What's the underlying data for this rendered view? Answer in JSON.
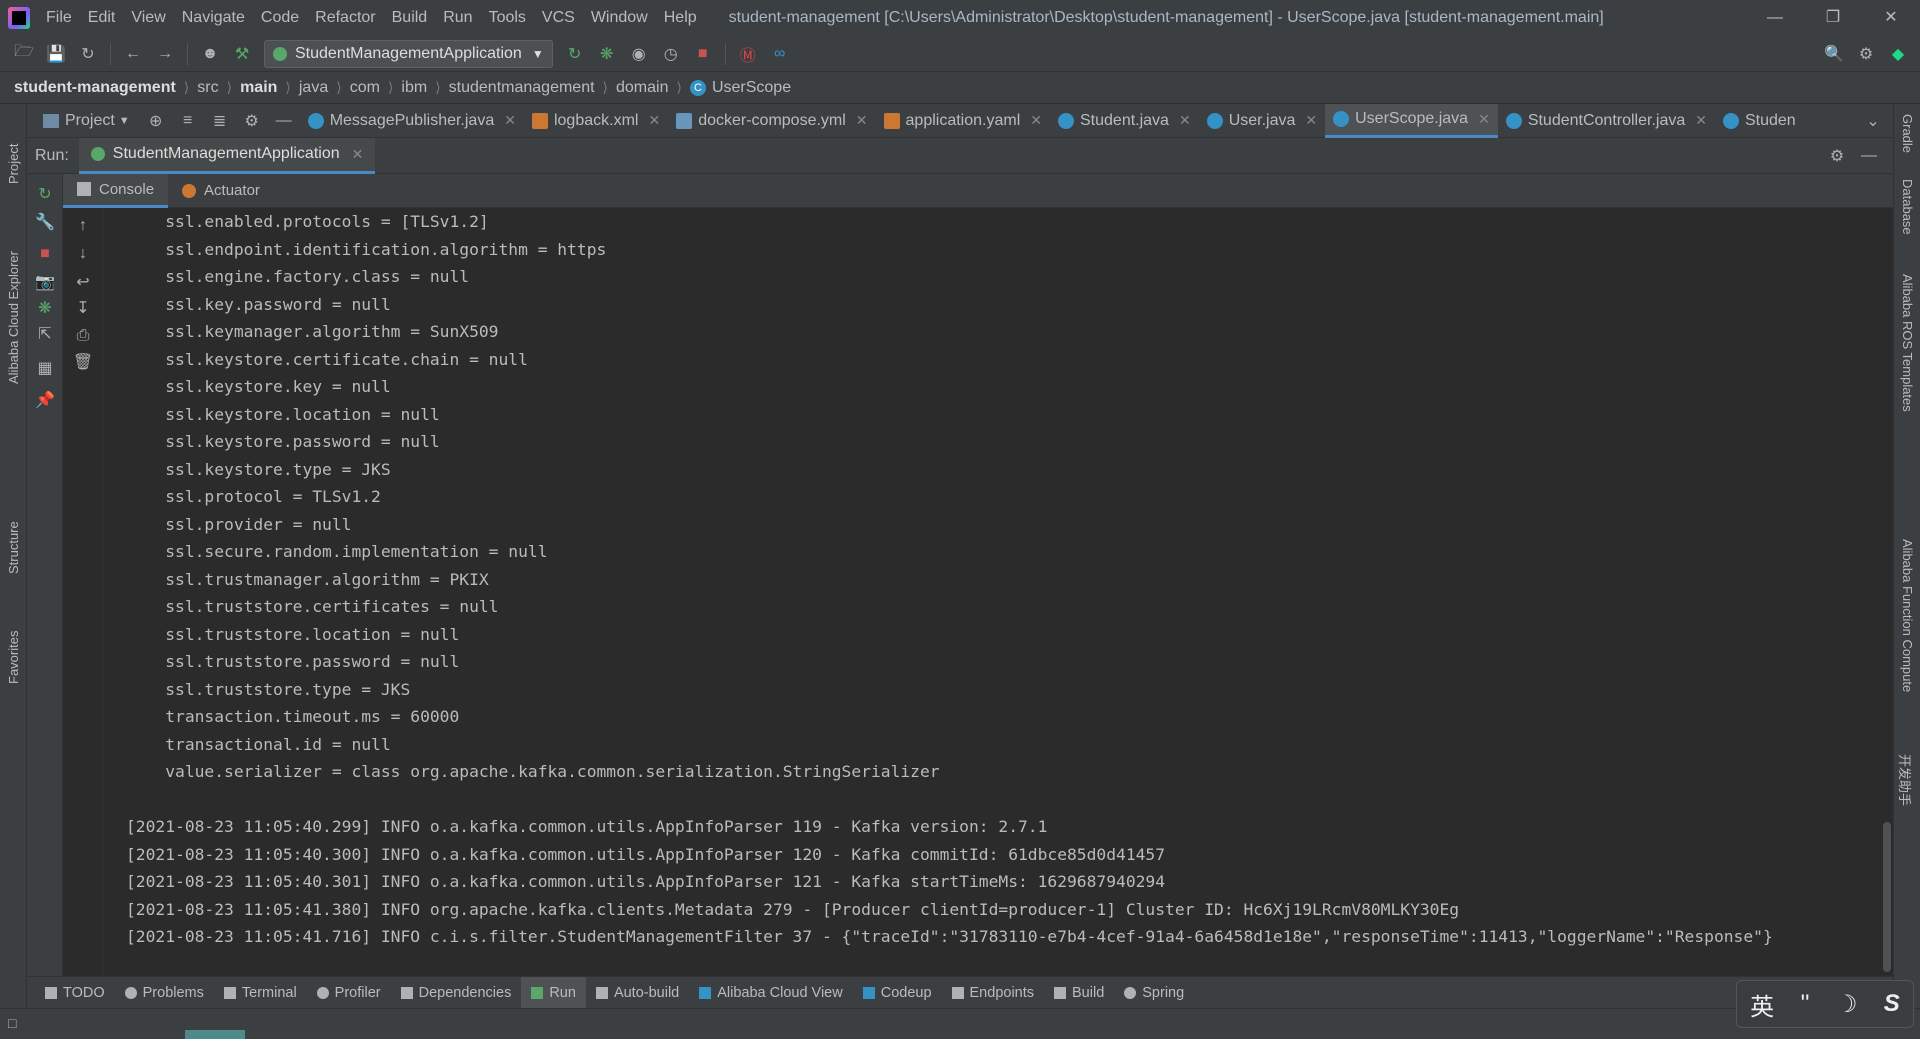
{
  "menu": [
    "File",
    "Edit",
    "View",
    "Navigate",
    "Code",
    "Refactor",
    "Build",
    "Run",
    "Tools",
    "VCS",
    "Window",
    "Help"
  ],
  "window_title": "student-management [C:\\Users\\Administrator\\Desktop\\student-management] - UserScope.java [student-management.main]",
  "run_config": "StudentManagementApplication",
  "breadcrumb": [
    "student-management",
    "src",
    "main",
    "java",
    "com",
    "ibm",
    "studentmanagement",
    "domain",
    "UserScope"
  ],
  "project_label": "Project",
  "editor_tabs": [
    {
      "label": "MessagePublisher.java",
      "icon": "class-icon"
    },
    {
      "label": "logback.xml",
      "icon": "xml-icon"
    },
    {
      "label": "docker-compose.yml",
      "icon": "yaml-icon"
    },
    {
      "label": "application.yaml",
      "icon": "yaml-icon"
    },
    {
      "label": "Student.java",
      "icon": "class-icon"
    },
    {
      "label": "User.java",
      "icon": "class-icon"
    },
    {
      "label": "UserScope.java",
      "icon": "class-icon",
      "active": true
    },
    {
      "label": "StudentController.java",
      "icon": "class-icon"
    },
    {
      "label": "Studen",
      "icon": "class-icon"
    }
  ],
  "run": {
    "label": "Run:",
    "tab": "StudentManagementApplication",
    "console_tabs": [
      "Console",
      "Actuator"
    ]
  },
  "console_lines": [
    "    ssl.enabled.protocols = [TLSv1.2]",
    "    ssl.endpoint.identification.algorithm = https",
    "    ssl.engine.factory.class = null",
    "    ssl.key.password = null",
    "    ssl.keymanager.algorithm = SunX509",
    "    ssl.keystore.certificate.chain = null",
    "    ssl.keystore.key = null",
    "    ssl.keystore.location = null",
    "    ssl.keystore.password = null",
    "    ssl.keystore.type = JKS",
    "    ssl.protocol = TLSv1.2",
    "    ssl.provider = null",
    "    ssl.secure.random.implementation = null",
    "    ssl.trustmanager.algorithm = PKIX",
    "    ssl.truststore.certificates = null",
    "    ssl.truststore.location = null",
    "    ssl.truststore.password = null",
    "    ssl.truststore.type = JKS",
    "    transaction.timeout.ms = 60000",
    "    transactional.id = null",
    "    value.serializer = class org.apache.kafka.common.serialization.StringSerializer",
    "",
    "[2021-08-23 11:05:40.299] INFO o.a.kafka.common.utils.AppInfoParser 119 - Kafka version: 2.7.1",
    "[2021-08-23 11:05:40.300] INFO o.a.kafka.common.utils.AppInfoParser 120 - Kafka commitId: 61dbce85d0d41457",
    "[2021-08-23 11:05:40.301] INFO o.a.kafka.common.utils.AppInfoParser 121 - Kafka startTimeMs: 1629687940294",
    "[2021-08-23 11:05:41.380] INFO org.apache.kafka.clients.Metadata 279 - [Producer clientId=producer-1] Cluster ID: Hc6Xj19LRcmV80MLKY30Eg",
    "[2021-08-23 11:05:41.716] INFO c.i.s.filter.StudentManagementFilter 37 - {\"traceId\":\"31783110-e7b4-4cef-91a4-6a6458d1e18e\",\"responseTime\":11413,\"loggerName\":\"Response\"}"
  ],
  "left_stripe": [
    "Project",
    "Alibaba Cloud Explorer",
    "Structure",
    "Favorites"
  ],
  "right_stripe": [
    "Gradle",
    "Database",
    "Alibaba ROS Templates",
    "Alibaba Function Compute",
    "开发助手"
  ],
  "bottom_tools": [
    {
      "label": "TODO"
    },
    {
      "label": "Problems"
    },
    {
      "label": "Terminal"
    },
    {
      "label": "Profiler"
    },
    {
      "label": "Dependencies"
    },
    {
      "label": "Run",
      "active": true
    },
    {
      "label": "Auto-build"
    },
    {
      "label": "Alibaba Cloud View"
    },
    {
      "label": "Codeup"
    },
    {
      "label": "Endpoints"
    },
    {
      "label": "Build"
    },
    {
      "label": "Spring"
    }
  ],
  "ime": {
    "lang": "英",
    "punct": "''",
    "moon": "☽",
    "logo": "S"
  },
  "colors": {
    "accent": "#4a88c7",
    "background": "#2b2b2b",
    "panel": "#3c3f41",
    "run_green": "#59a869",
    "stop_red": "#c75450"
  }
}
